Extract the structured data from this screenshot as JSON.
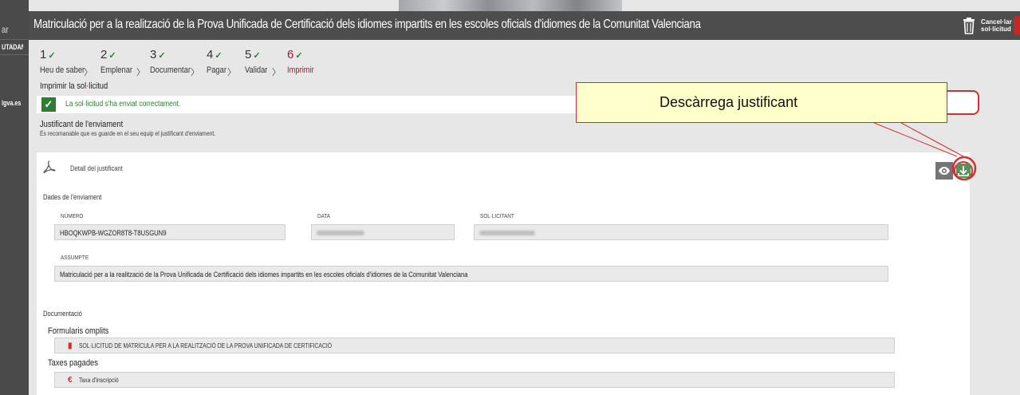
{
  "sidebar": {
    "items": [
      "ar",
      "UTADANA",
      "lgva.es"
    ]
  },
  "header": {
    "title": "Matriculació per a la realització de la Prova Unificada de Certificació dels idiomes impartits en les escoles oficials d'idiomes de la Comunitat Valenciana",
    "cancel_label": "Cancel·lar sol·licitud"
  },
  "steps": [
    {
      "num": "1",
      "label": "Heu de saber"
    },
    {
      "num": "2",
      "label": "Emplenar"
    },
    {
      "num": "3",
      "label": "Documentar"
    },
    {
      "num": "4",
      "label": "Pagar"
    },
    {
      "num": "5",
      "label": "Validar"
    },
    {
      "num": "6",
      "label": "Imprimir"
    }
  ],
  "page_title": "Imprimir la sol·licitud",
  "success_message": "La sol·licitud s'ha enviat correctament.",
  "justificant": {
    "title": "Justificant de l'enviament",
    "subtitle": "És recomanable que es guarde en el seu equip el justificant d'enviament.",
    "detail_label": "Detall del justificant"
  },
  "dades": {
    "section": "Dades de l'enviament",
    "numero_label": "NÚMERO",
    "numero_value": "HBOQKWPB-WGZOR8T8-T8USGUN9",
    "data_label": "DATA",
    "sollicitant_label": "SOL·LICITANT",
    "assumpte_label": "ASSUMPTE",
    "assumpte_value": "Matriculació per a la realització de la Prova Unificada de Certificació dels idiomes impartits en les escoles oficials d'idiomes de la Comunitat Valenciana"
  },
  "documentacio": {
    "section": "Documentació",
    "formularis_title": "Formularis omplits",
    "formulari_item": "SOL·LICITUD DE MATRÍCULA PER A LA REALITZACIÓ DE LA PROVA UNIFICADA DE CERTIFICACIÓ",
    "taxes_title": "Taxes pagades",
    "taxa_item": "Taxa d'inscripció"
  },
  "callout": {
    "text": "Descàrrega justificant"
  },
  "colors": {
    "header_bg": "#4d4d4d",
    "success_green": "#2e7d32",
    "active_step": "#9e1b32",
    "highlight_red": "#d32f2f",
    "callout_bg": "#ffffcc"
  },
  "icons": [
    "trash-icon",
    "check-icon",
    "pdf-icon",
    "eye-icon",
    "download-icon",
    "clipboard-icon",
    "euro-icon"
  ]
}
